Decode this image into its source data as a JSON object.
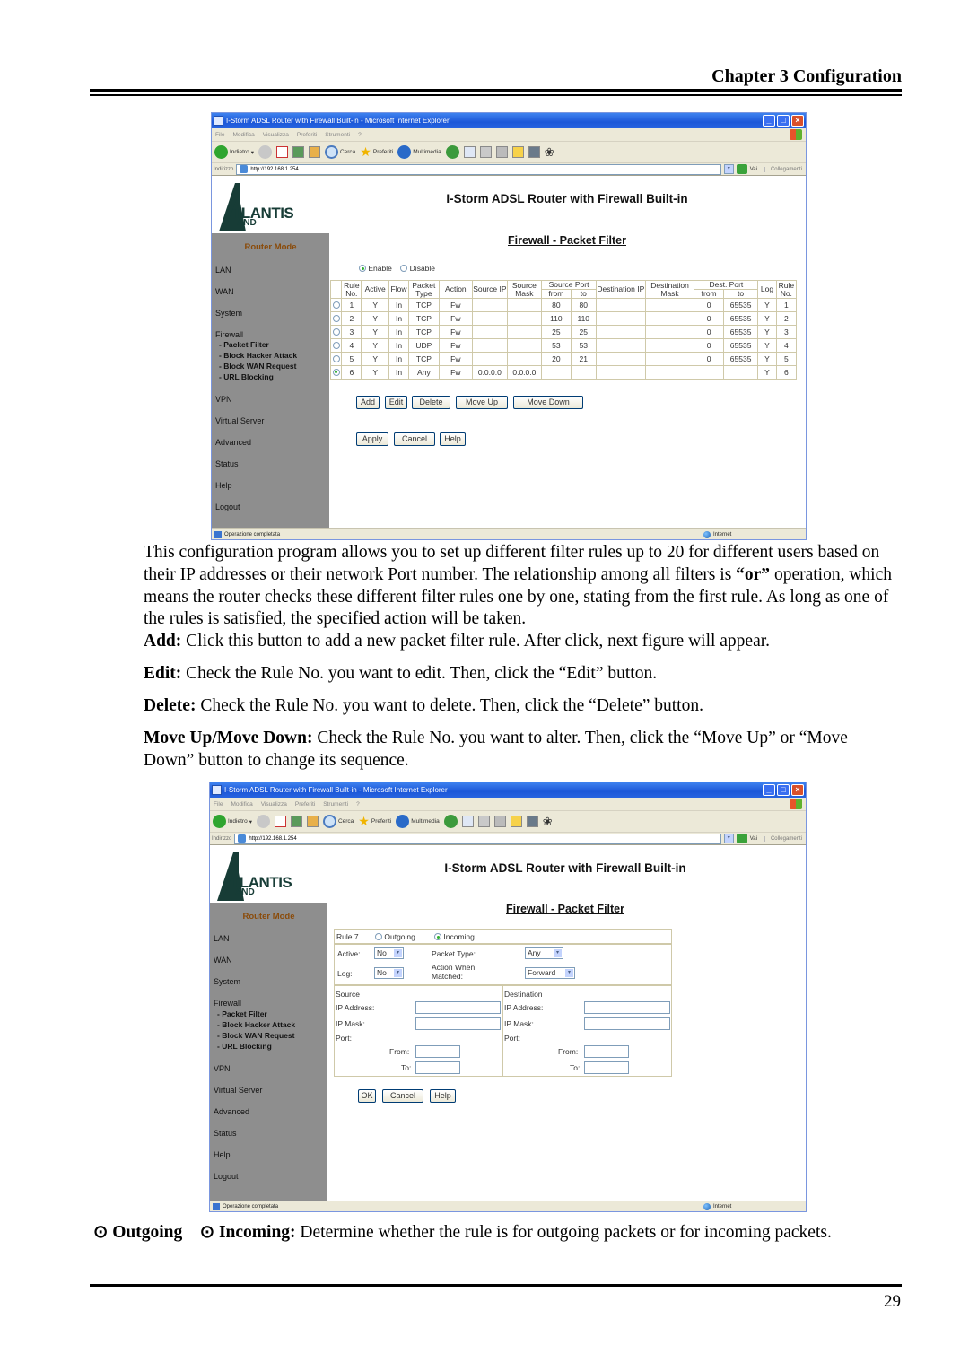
{
  "header": {
    "chapter": "Chapter 3 Configuration"
  },
  "browser": {
    "window_title": "I-Storm ADSL Router with Firewall Built-in - Microsoft Internet Explorer",
    "menu": [
      "File",
      "Modifica",
      "Visualizza",
      "Preferiti",
      "Strumenti",
      "?"
    ],
    "toolbar": {
      "back": "Indietro",
      "search": "Cerca",
      "favorites": "Preferiti",
      "media": "Multimedia"
    },
    "address_label": "Indirizzo",
    "address_url": "http://192.168.1.254",
    "go_label": "Vai",
    "links_label": "Collegamenti",
    "status_text": "Operazione completata",
    "zone_text": "Internet"
  },
  "router": {
    "logo_text": "TLANTIS",
    "logo_sub": "AND",
    "title": "I-Storm ADSL Router with Firewall Built-in",
    "sidebar": {
      "mode": "Router Mode",
      "items": [
        "LAN",
        "WAN",
        "System",
        "Firewall",
        "VPN",
        "Virtual Server",
        "Advanced",
        "Status",
        "Help",
        "Logout"
      ],
      "firewall_sub": [
        "- Packet Filter",
        "- Block Hacker Attack",
        "- Block WAN Request",
        "- URL Blocking"
      ]
    }
  },
  "screen1": {
    "page_title": "Firewall - Packet Filter",
    "enable_label": "Enable",
    "disable_label": "Disable",
    "enabled": true,
    "columns": {
      "rule_no": "Rule No.",
      "active": "Active",
      "flow": "Flow",
      "packet_type": "Packet Type",
      "action": "Action",
      "source_ip": "Source IP",
      "source_mask": "Source Mask",
      "source_port": "Source Port",
      "dest_ip": "Destination IP",
      "dest_mask": "Destination Mask",
      "dest_port": "Dest. Port",
      "from": "from",
      "to": "to",
      "log": "Log"
    },
    "rules": [
      {
        "no": "1",
        "active": "Y",
        "flow": "In",
        "type": "TCP",
        "action": "Fw",
        "src_ip": "",
        "src_mask": "",
        "sp_from": "80",
        "sp_to": "80",
        "dst_ip": "",
        "dst_mask": "",
        "dp_from": "0",
        "dp_to": "65535",
        "log": "Y",
        "selected": false
      },
      {
        "no": "2",
        "active": "Y",
        "flow": "In",
        "type": "TCP",
        "action": "Fw",
        "src_ip": "",
        "src_mask": "",
        "sp_from": "110",
        "sp_to": "110",
        "dst_ip": "",
        "dst_mask": "",
        "dp_from": "0",
        "dp_to": "65535",
        "log": "Y",
        "selected": false
      },
      {
        "no": "3",
        "active": "Y",
        "flow": "In",
        "type": "TCP",
        "action": "Fw",
        "src_ip": "",
        "src_mask": "",
        "sp_from": "25",
        "sp_to": "25",
        "dst_ip": "",
        "dst_mask": "",
        "dp_from": "0",
        "dp_to": "65535",
        "log": "Y",
        "selected": false
      },
      {
        "no": "4",
        "active": "Y",
        "flow": "In",
        "type": "UDP",
        "action": "Fw",
        "src_ip": "",
        "src_mask": "",
        "sp_from": "53",
        "sp_to": "53",
        "dst_ip": "",
        "dst_mask": "",
        "dp_from": "0",
        "dp_to": "65535",
        "log": "Y",
        "selected": false
      },
      {
        "no": "5",
        "active": "Y",
        "flow": "In",
        "type": "TCP",
        "action": "Fw",
        "src_ip": "",
        "src_mask": "",
        "sp_from": "20",
        "sp_to": "21",
        "dst_ip": "",
        "dst_mask": "",
        "dp_from": "0",
        "dp_to": "65535",
        "log": "Y",
        "selected": false
      },
      {
        "no": "6",
        "active": "Y",
        "flow": "In",
        "type": "Any",
        "action": "Fw",
        "src_ip": "0.0.0.0",
        "src_mask": "0.0.0.0",
        "sp_from": "",
        "sp_to": "",
        "dst_ip": "",
        "dst_mask": "",
        "dp_from": "",
        "dp_to": "",
        "log": "Y",
        "selected": true
      }
    ],
    "buttons": {
      "add": "Add",
      "edit": "Edit",
      "delete": "Delete",
      "move_up": "Move Up",
      "move_down": "Move Down",
      "apply": "Apply",
      "cancel": "Cancel",
      "help": "Help"
    }
  },
  "text": {
    "intro": "This configuration program allows you to set up different filter rules up to 20 for different users based on their IP addresses or their network Port number. The relationship among all filters is",
    "intro_or": "“or”",
    "intro_rest": " operation, which means the router checks these different filter rules one by one, stating from the first rule. As long as one of the rules is satisfied, the specified action will be taken.",
    "add_term": "Add:",
    "add_desc": " Click this button to add a new packet filter rule. After click, next figure will appear.",
    "edit_term": "Edit:",
    "edit_desc": " Check the Rule No. you want to edit. Then, click the “Edit” button.",
    "delete_term": "Delete:",
    "delete_desc": " Check the Rule No. you want to delete. Then, click the “Delete” button.",
    "move_term": "Move Up/Move Down:",
    "move_desc": " Check the Rule No. you want to alter. Then, click the “Move Up” or “Move Down” button to change its sequence.",
    "outgoing_term": "⊙ Outgoing",
    "incoming_term": "⊙ Incoming:",
    "direction_desc": " Determine whether the rule is for outgoing packets or for incoming packets."
  },
  "screen2": {
    "page_title": "Firewall - Packet Filter",
    "rule_label": "Rule 7",
    "outgoing_label": "Outgoing",
    "incoming_label": "Incoming",
    "direction": "Incoming",
    "active_label": "Active:",
    "active_value": "No",
    "log_label": "Log:",
    "log_value": "No",
    "packet_type_label": "Packet Type:",
    "packet_type_value": "Any",
    "action_label": "Action When Matched:",
    "action_value": "Forward",
    "source_label": "Source",
    "destination_label": "Destination",
    "ip_address_label": "IP Address:",
    "ip_mask_label": "IP Mask:",
    "port_label": "Port:",
    "from_label": "From:",
    "to_label": "To:",
    "buttons": {
      "ok": "OK",
      "cancel": "Cancel",
      "help": "Help"
    }
  },
  "footer": {
    "page_number": "29"
  }
}
